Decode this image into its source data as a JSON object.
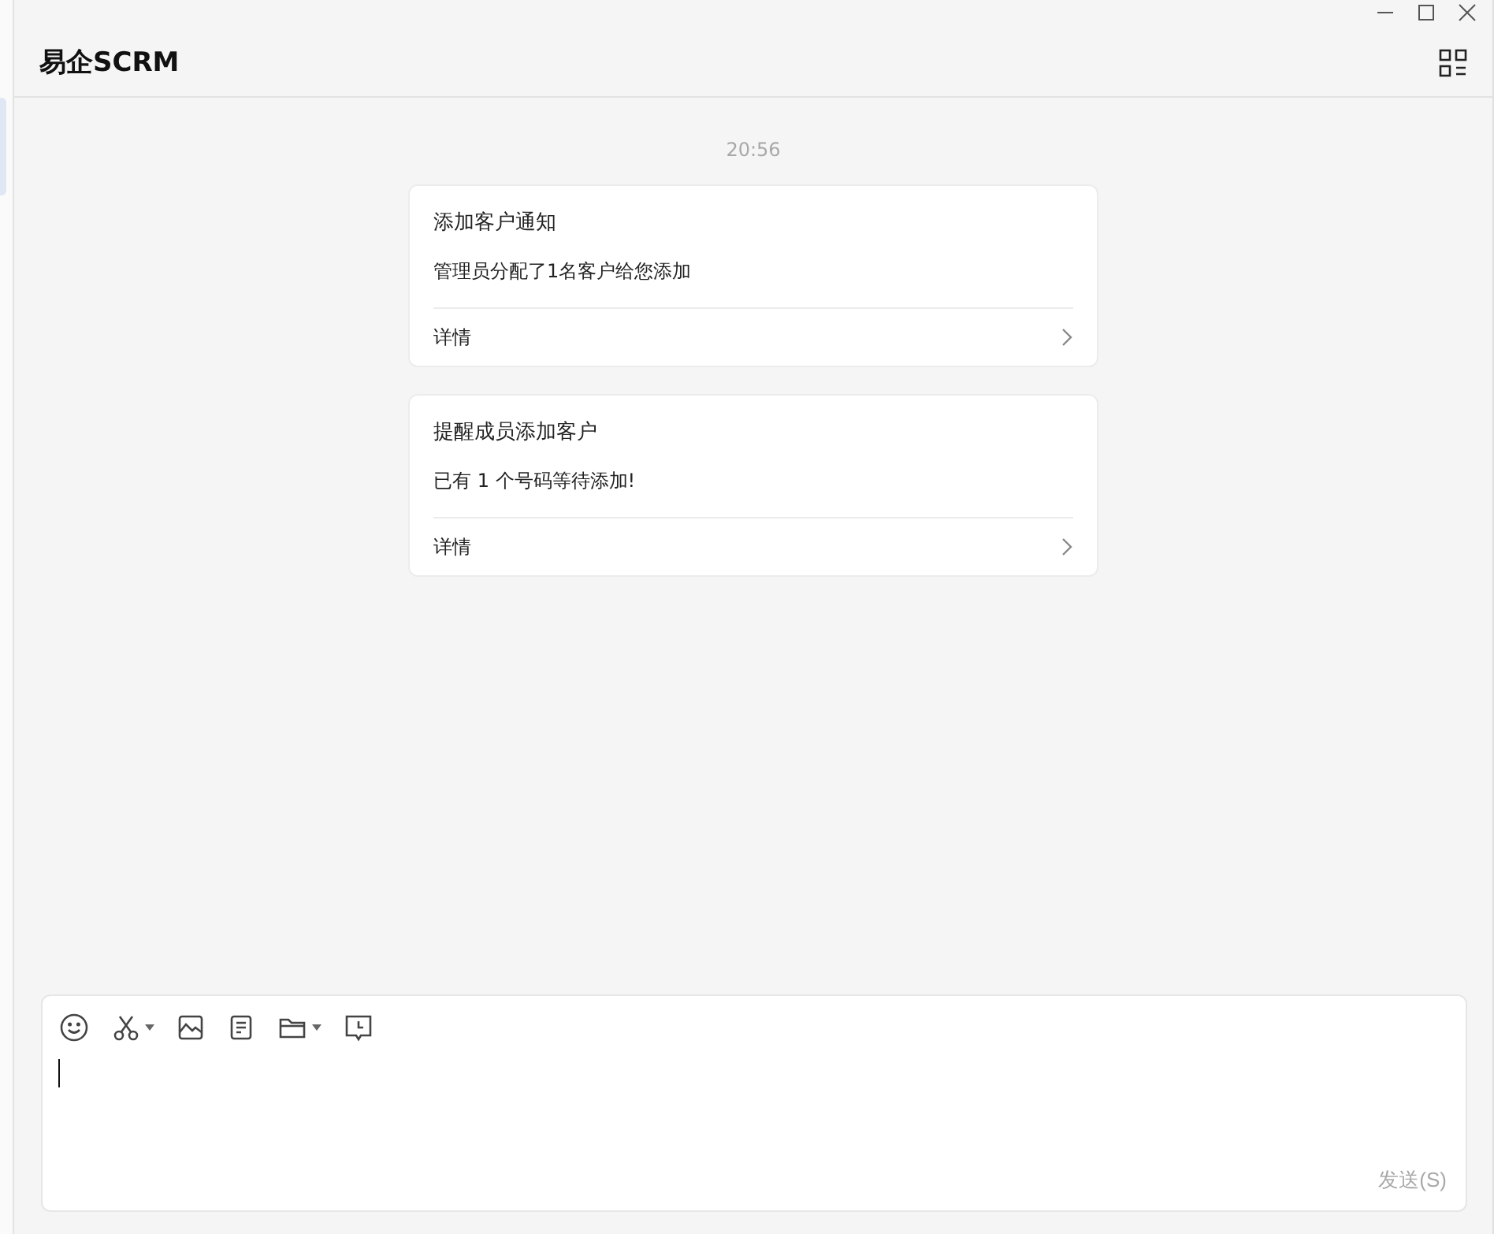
{
  "window": {
    "title": "易企SCRM"
  },
  "timestamp": "20:56",
  "messages": [
    {
      "title": "添加客户通知",
      "body": "管理员分配了1名客户给您添加",
      "link": "详情"
    },
    {
      "title": "提醒成员添加客户",
      "body": "已有 1 个号码等待添加!",
      "link": "详情"
    }
  ],
  "toolbar": [
    {
      "kind": "emoji",
      "dropdown": false
    },
    {
      "kind": "scissors",
      "dropdown": true
    },
    {
      "kind": "image",
      "dropdown": false
    },
    {
      "kind": "document",
      "dropdown": false
    },
    {
      "kind": "folder",
      "dropdown": true
    },
    {
      "kind": "schedule",
      "dropdown": false
    }
  ],
  "send_button": {
    "label": "发送(S)",
    "disabled": true
  }
}
